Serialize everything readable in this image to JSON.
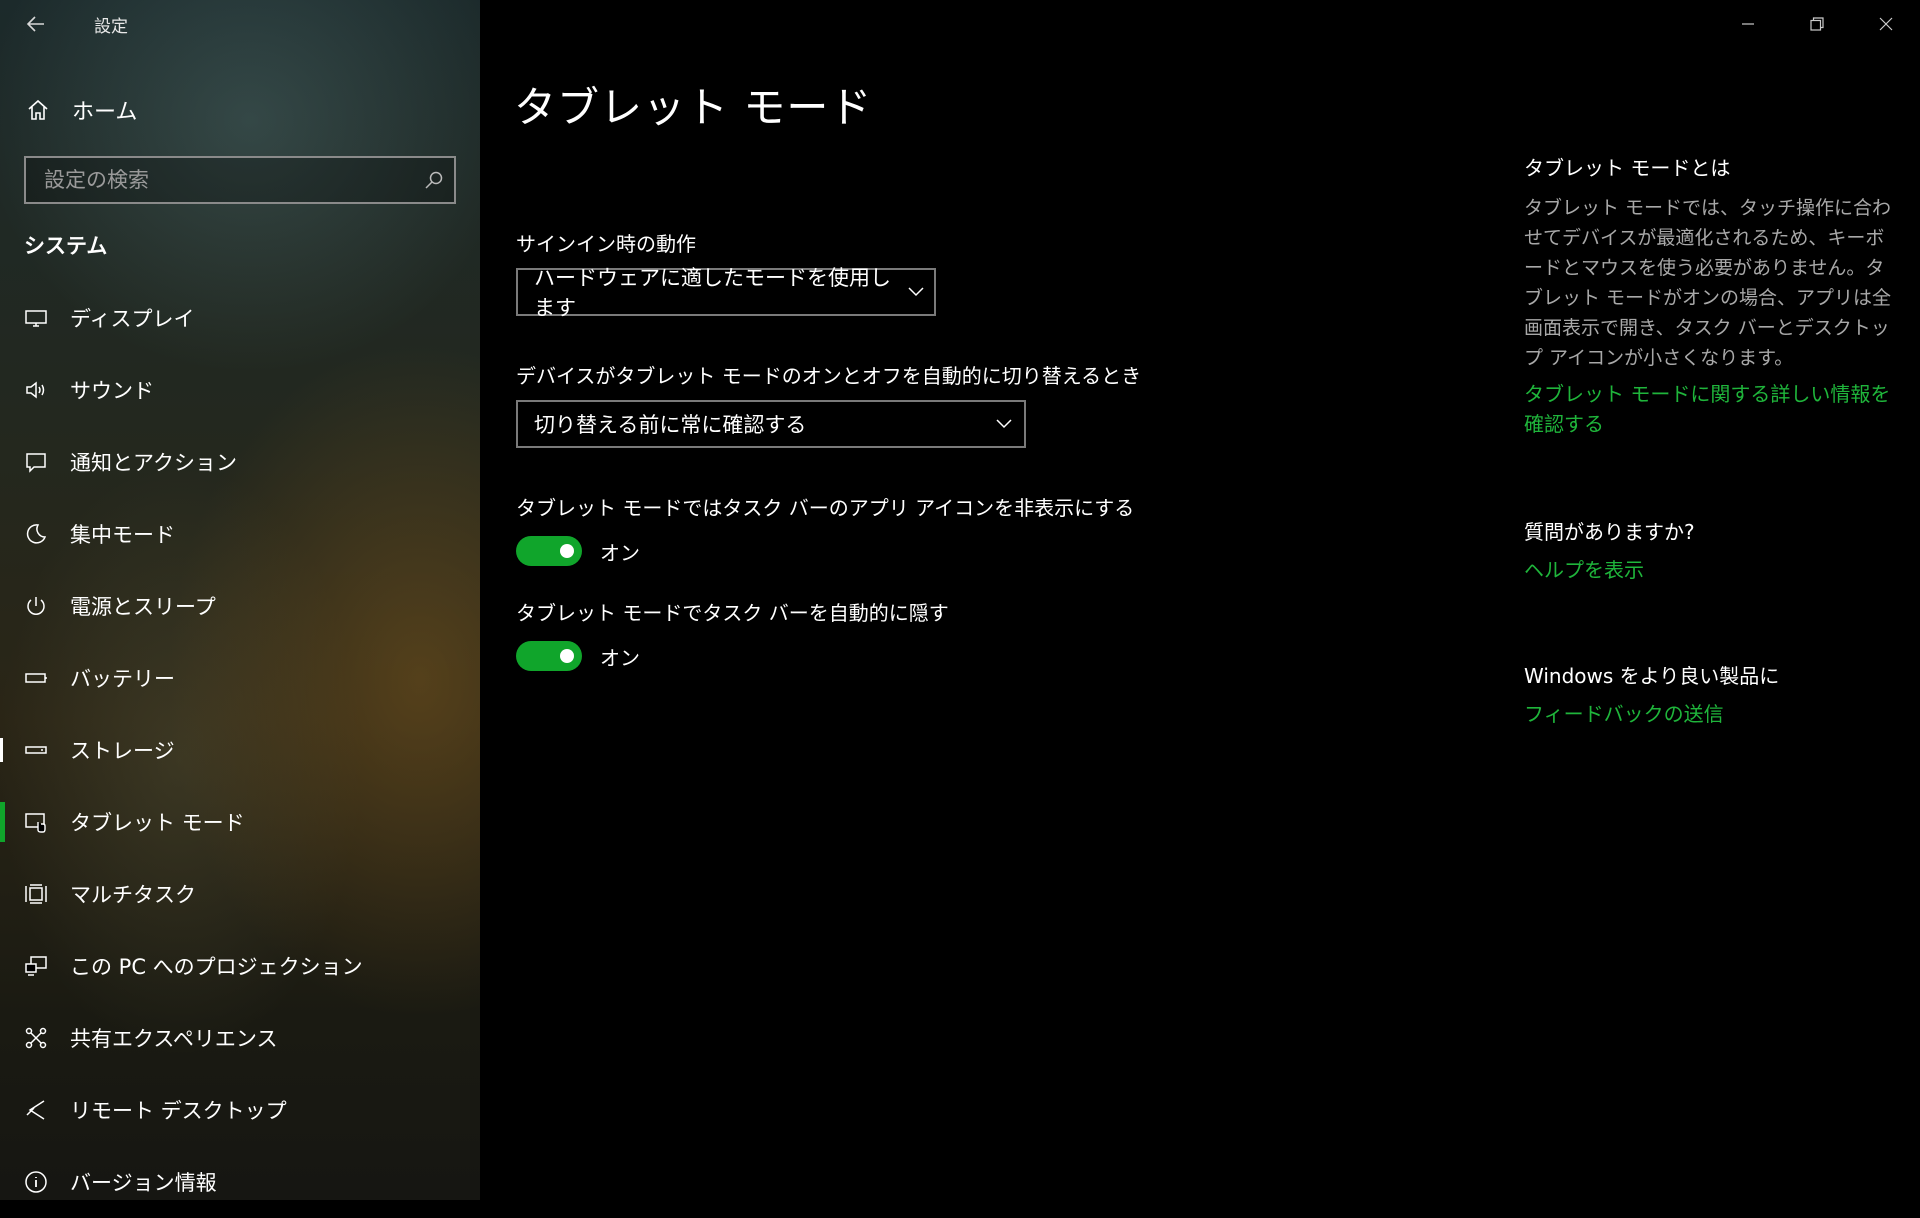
{
  "window": {
    "title": "設定"
  },
  "sidebar": {
    "home_label": "ホーム",
    "search_placeholder": "設定の検索",
    "section_title": "システム",
    "items": [
      {
        "label": "ディスプレイ",
        "icon": "display-icon"
      },
      {
        "label": "サウンド",
        "icon": "speaker-icon"
      },
      {
        "label": "通知とアクション",
        "icon": "notification-icon"
      },
      {
        "label": "集中モード",
        "icon": "moon-icon"
      },
      {
        "label": "電源とスリープ",
        "icon": "power-icon"
      },
      {
        "label": "バッテリー",
        "icon": "battery-icon"
      },
      {
        "label": "ストレージ",
        "icon": "storage-icon"
      },
      {
        "label": "タブレット モード",
        "icon": "tablet-mode-icon",
        "selected": true
      },
      {
        "label": "マルチタスク",
        "icon": "multitask-icon"
      },
      {
        "label": "この PC へのプロジェクション",
        "icon": "projection-icon"
      },
      {
        "label": "共有エクスペリエンス",
        "icon": "shared-experience-icon"
      },
      {
        "label": "リモート デスクトップ",
        "icon": "remote-desktop-icon"
      },
      {
        "label": "バージョン情報",
        "icon": "info-icon"
      }
    ]
  },
  "main": {
    "page_title": "タブレット モード",
    "signin": {
      "label": "サインイン時の動作",
      "value": "ハードウェアに適したモードを使用します"
    },
    "auto_switch": {
      "label": "デバイスがタブレット モードのオンとオフを自動的に切り替えるとき",
      "value": "切り替える前に常に確認する"
    },
    "hide_icons": {
      "label": "タブレット モードではタスク バーのアプリ アイコンを非表示にする",
      "state": "オン",
      "on": true
    },
    "auto_hide_taskbar": {
      "label": "タブレット モードでタスク バーを自動的に隠す",
      "state": "オン",
      "on": true
    }
  },
  "info": {
    "about_title": "タブレット モードとは",
    "about_body": "タブレット モードでは、タッチ操作に合わせてデバイスが最適化されるため、キーボードとマウスを使う必要がありません。タブレット モードがオンの場合、アプリは全画面表示で開き、タスク バーとデスクトップ アイコンが小さくなります。",
    "about_link": "タブレット モードに関する詳しい情報を確認する",
    "question_title": "質問がありますか?",
    "help_link": "ヘルプを表示",
    "feedback_title": "Windows をより良い製品に",
    "feedback_link": "フィードバックの送信"
  },
  "colors": {
    "accent": "#10a52b",
    "link": "#1fb53b",
    "background": "#000000"
  }
}
